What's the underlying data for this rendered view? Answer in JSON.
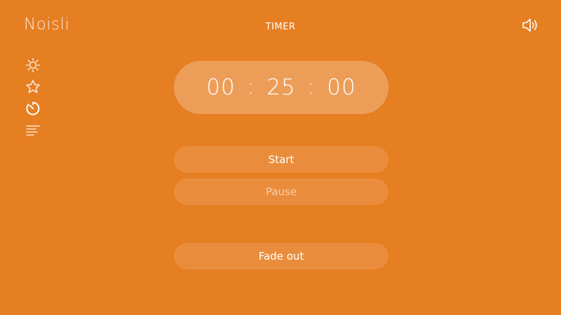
{
  "app": {
    "logo": "Noisli"
  },
  "header": {
    "title": "TIMER",
    "volume_icon": "speaker-volume-icon"
  },
  "sidebar": {
    "items": [
      {
        "icon": "sun-icon",
        "active": false
      },
      {
        "icon": "star-icon",
        "active": false
      },
      {
        "icon": "timer-icon",
        "active": true
      },
      {
        "icon": "text-lines-icon",
        "active": false
      }
    ]
  },
  "timer": {
    "hours": "00",
    "minutes": "25",
    "seconds": "00",
    "separator": ":"
  },
  "controls": {
    "start_label": "Start",
    "pause_label": "Pause",
    "fade_label": "Fade out"
  },
  "colors": {
    "background": "#e67e22",
    "text": "#ffffff"
  }
}
